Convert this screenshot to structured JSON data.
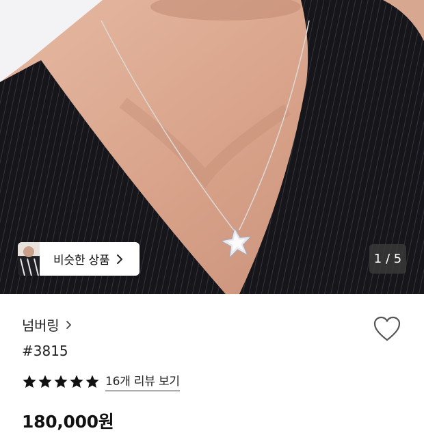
{
  "gallery": {
    "counter_text": "1 / 5",
    "similar_products_label": "비슷한 상품"
  },
  "product": {
    "brand": "넘버링",
    "name": "#3815",
    "review_link": "16개 리뷰 보기",
    "rating": 5,
    "price": "180,000원"
  },
  "icons": {
    "similar_chevron": "chevron-right-icon",
    "brand_chevron": "chevron-right-icon",
    "wishlist": "heart-outline-icon",
    "star": "star-filled-icon"
  },
  "colors": {
    "text": "#111111",
    "garment": "#15151a",
    "skin": "#d9a78f",
    "counter_bg": "#3a3a3a"
  }
}
